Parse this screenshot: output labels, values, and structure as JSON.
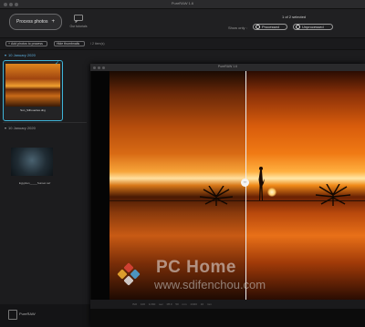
{
  "app": {
    "title": "PureRAW 1.6"
  },
  "toolbar": {
    "process_button": "Process photos",
    "tutorial_label": "Our tutorials",
    "selection_count": "1 of 2 selected",
    "show_only_label": "Show only :",
    "filter_processed": "Processed",
    "filter_unprocessed": "Unprocessed"
  },
  "subbar": {
    "add_button": "Add photos to process",
    "thumbnail_button": "Hide thumbnails",
    "item_count": "/ 2 item(s)"
  },
  "sidebar": {
    "groups": [
      {
        "date": "10 January 2020",
        "items": [
          {
            "label": "Sun_Silhouettes.dng",
            "selected": true
          }
        ]
      },
      {
        "date": "10 January 2020",
        "items": [
          {
            "label": "Egyptian_____Sunset.nef",
            "selected": false
          }
        ]
      }
    ],
    "footer_label": "PureRAW"
  },
  "compare_window": {
    "title": "PureRAW 1.6",
    "status": "ISO 100 1/160 sec f/8.0 50 mm 1/320 16 mm"
  },
  "watermark": {
    "title": "PC Home",
    "url": "www.sdifenchou.com"
  },
  "colors": {
    "accent": "#3fb4d8",
    "background": "#1c1c1e"
  }
}
